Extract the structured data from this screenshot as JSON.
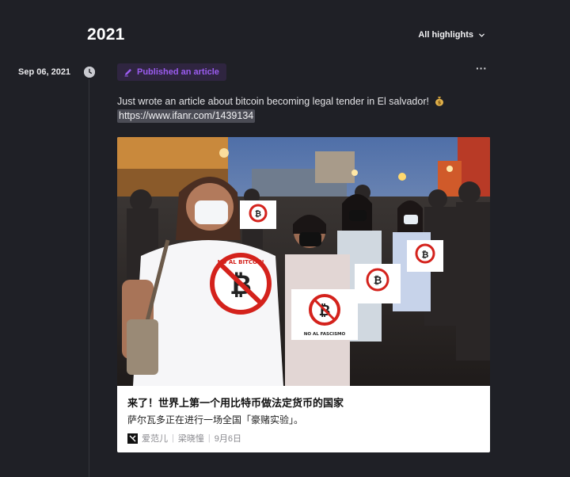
{
  "header": {
    "year": "2021",
    "filter_label": "All highlights"
  },
  "event": {
    "date": "Sep 06, 2021",
    "badge_label": "Published an article",
    "more_label": "···",
    "text": "Just wrote an article about bitcoin becoming legal tender in El salvador!",
    "emoji": "money-bag-icon",
    "link": "https://www.ifanr.com/1439134"
  },
  "card": {
    "title": "来了！世界上第一个用比特币做法定货币的国家",
    "subtitle": "萨尔瓦多正在进行一场全国「豪赌实验」。",
    "source": "爱范儿",
    "author": "梁晓憧",
    "date": "9月6日",
    "image_signs": {
      "main_shirt": "NO AL BITCOIN",
      "held_sign": "NO AL FASCISMO"
    }
  },
  "colors": {
    "background": "#1f2026",
    "accent_purple": "#9b5cf0",
    "badge_bg": "#2f2540"
  }
}
